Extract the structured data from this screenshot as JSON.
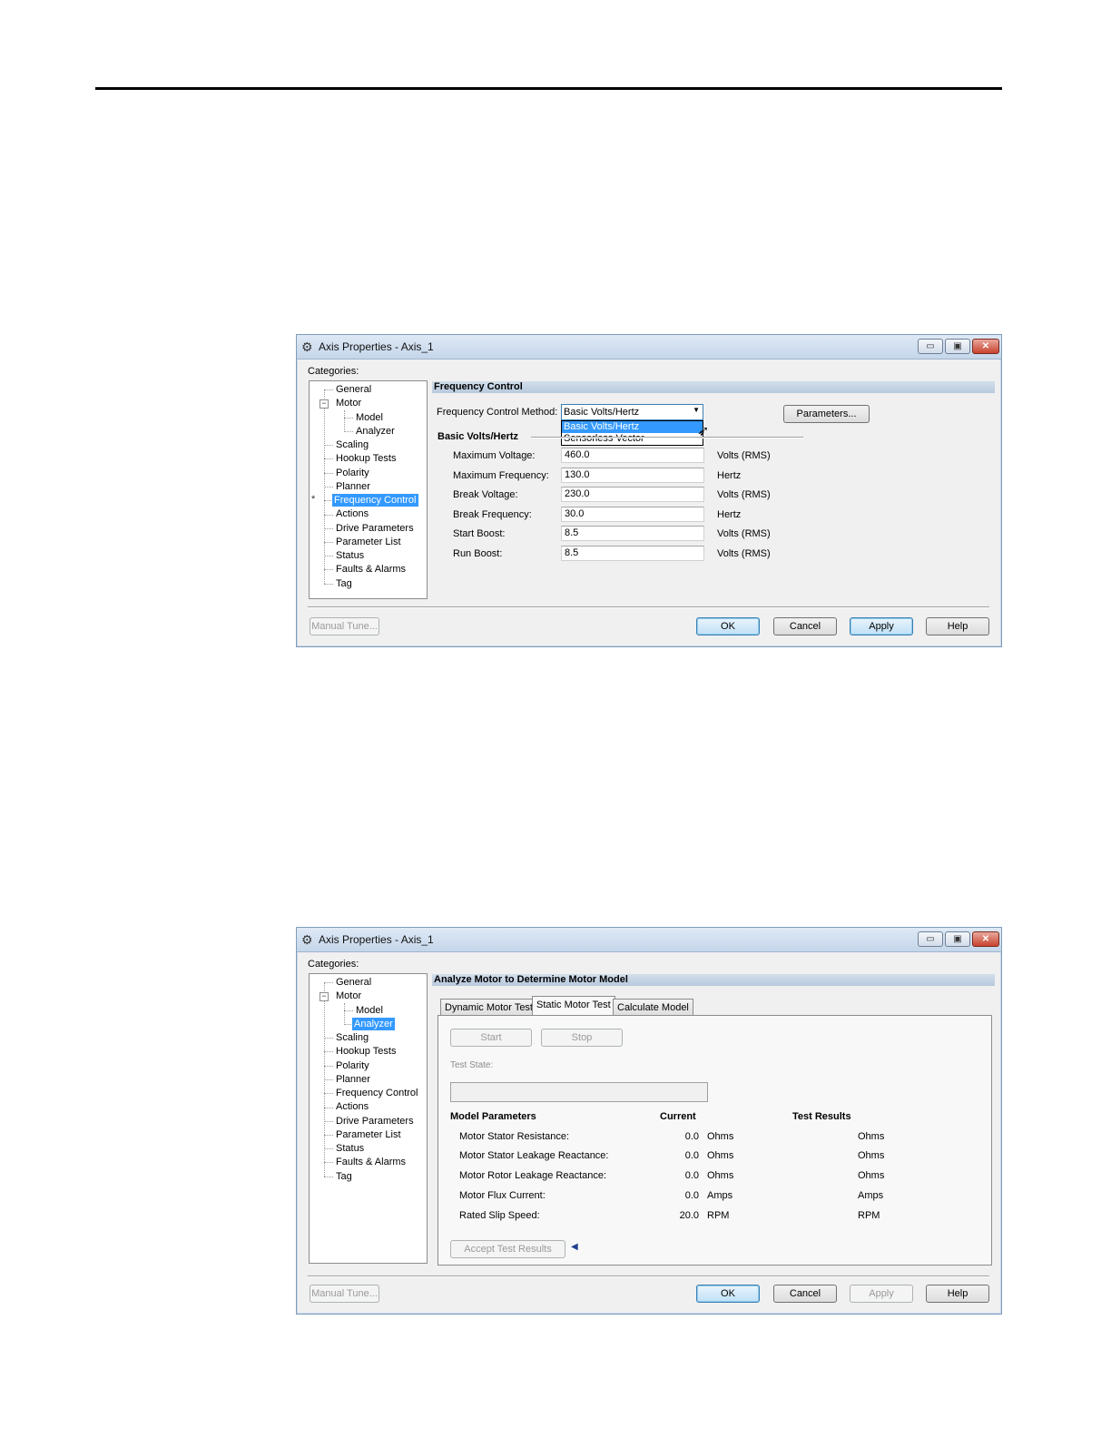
{
  "dialog1": {
    "title": "Axis Properties - Axis_1",
    "categories_label": "Categories:",
    "section_title": "Frequency Control",
    "method_label": "Frequency Control Method:",
    "method_value": "Basic Volts/Hertz",
    "method_options": [
      "Basic Volts/Hertz",
      "Sensorless Vector"
    ],
    "parameters_button": "Parameters...",
    "group_label": "Basic Volts/Hertz",
    "fields": [
      {
        "label": "Maximum Voltage:",
        "value": "460.0",
        "unit": "Volts (RMS)"
      },
      {
        "label": "Maximum Frequency:",
        "value": "130.0",
        "unit": "Hertz"
      },
      {
        "label": "Break Voltage:",
        "value": "230.0",
        "unit": "Volts (RMS)"
      },
      {
        "label": "Break Frequency:",
        "value": "30.0",
        "unit": "Hertz"
      },
      {
        "label": "Start Boost:",
        "value": "8.5",
        "unit": "Volts (RMS)"
      },
      {
        "label": "Run Boost:",
        "value": "8.5",
        "unit": "Volts (RMS)"
      }
    ],
    "selected_category": "Frequency Control",
    "marker": "*"
  },
  "dialog2": {
    "title": "Axis Properties - Axis_1",
    "categories_label": "Categories:",
    "section_title": "Analyze Motor to Determine Motor Model",
    "tabs": [
      "Dynamic Motor Test",
      "Static Motor Test",
      "Calculate Model"
    ],
    "active_tab": "Static Motor Test",
    "start_button": "Start",
    "stop_button": "Stop",
    "test_state_label": "Test State:",
    "headers": {
      "model": "Model Parameters",
      "current": "Current",
      "results": "Test Results"
    },
    "params": [
      {
        "label": "Motor Stator Resistance:",
        "current": "0.0",
        "unit": "Ohms",
        "result_unit": "Ohms"
      },
      {
        "label": "Motor Stator Leakage Reactance:",
        "current": "0.0",
        "unit": "Ohms",
        "result_unit": "Ohms"
      },
      {
        "label": "Motor Rotor Leakage Reactance:",
        "current": "0.0",
        "unit": "Ohms",
        "result_unit": "Ohms"
      },
      {
        "label": "Motor Flux Current:",
        "current": "0.0",
        "unit": "Amps",
        "result_unit": "Amps"
      },
      {
        "label": "Rated Slip Speed:",
        "current": "20.0",
        "unit": "RPM",
        "result_unit": "RPM"
      }
    ],
    "accept_button": "Accept Test Results",
    "selected_category": "Analyzer"
  },
  "tree": {
    "items": [
      "General",
      "Motor",
      "Model",
      "Analyzer",
      "Scaling",
      "Hookup Tests",
      "Polarity",
      "Planner",
      "Frequency Control",
      "Actions",
      "Drive Parameters",
      "Parameter List",
      "Status",
      "Faults & Alarms",
      "Tag"
    ]
  },
  "footer": {
    "manual_tune": "Manual Tune...",
    "ok": "OK",
    "cancel": "Cancel",
    "apply": "Apply",
    "help": "Help"
  },
  "window_buttons": {
    "minimize": "▭",
    "maximize": "▣",
    "close": "✕"
  },
  "icons": {
    "app_icon": "gear-icon"
  }
}
